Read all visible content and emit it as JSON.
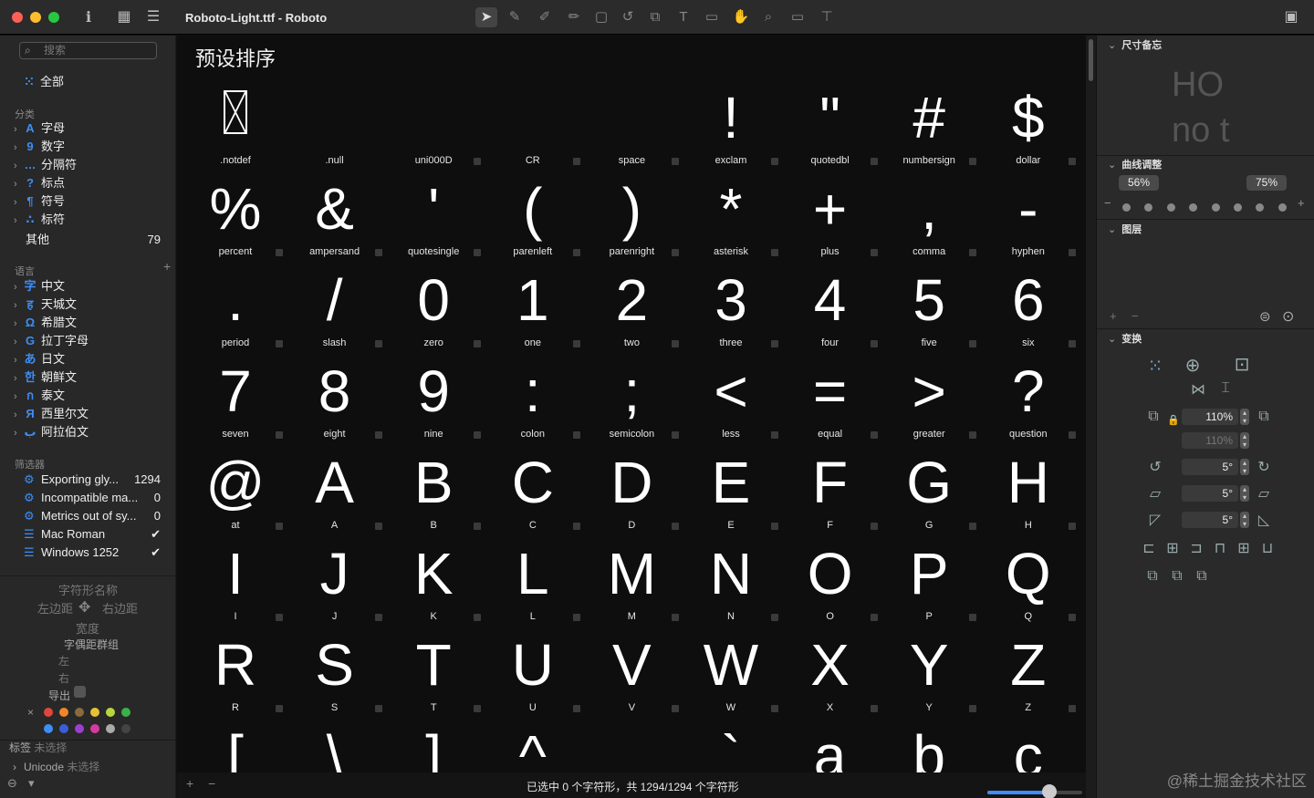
{
  "window": {
    "title": "Roboto-Light.ttf - Roboto"
  },
  "sidebar": {
    "search_placeholder": "搜索",
    "all": "全部",
    "categories_header": "分类",
    "categories": [
      {
        "icon": "A",
        "label": "字母"
      },
      {
        "icon": "9",
        "label": "数字"
      },
      {
        "icon": "…",
        "label": "分隔符"
      },
      {
        "icon": "?",
        "label": "标点"
      },
      {
        "icon": "¶",
        "label": "符号"
      },
      {
        "icon": "∴",
        "label": "标符"
      }
    ],
    "other": {
      "label": "其他",
      "count": "79"
    },
    "languages_header": "语言",
    "languages": [
      {
        "icon": "字",
        "label": "中文"
      },
      {
        "icon": "ह",
        "label": "天城文"
      },
      {
        "icon": "Ω",
        "label": "希腊文"
      },
      {
        "icon": "G",
        "label": "拉丁字母"
      },
      {
        "icon": "あ",
        "label": "日文"
      },
      {
        "icon": "한",
        "label": "朝鲜文"
      },
      {
        "icon": "ก",
        "label": "泰文"
      },
      {
        "icon": "Я",
        "label": "西里尔文"
      },
      {
        "icon": "ب",
        "label": "阿拉伯文"
      }
    ],
    "filters_header": "筛选器",
    "filters": [
      {
        "label": "Exporting gly...",
        "value": "1294"
      },
      {
        "label": "Incompatible ma...",
        "value": "0"
      },
      {
        "label": "Metrics out of sy...",
        "value": "0"
      },
      {
        "label": "Mac Roman",
        "value": "✔"
      },
      {
        "label": "Windows 1252",
        "value": "✔"
      }
    ],
    "info": {
      "glyph_name": "字符形名称",
      "left_sb": "左边距",
      "right_sb": "右边距",
      "width": "宽度",
      "kerning_group": "字偶距群组",
      "left": "左",
      "right": "右",
      "export": "导出"
    },
    "tags": {
      "label": "标签",
      "value": "未选择"
    },
    "unicode": {
      "label": "Unicode",
      "value": "未选择"
    }
  },
  "main": {
    "title": "预设排序",
    "glyphs": [
      {
        "char": "",
        "name": ".notdef"
      },
      {
        "char": "",
        "name": ".null"
      },
      {
        "char": "",
        "name": "uni000D"
      },
      {
        "char": "",
        "name": "CR"
      },
      {
        "char": "",
        "name": "space"
      },
      {
        "char": "!",
        "name": "exclam"
      },
      {
        "char": "\"",
        "name": "quotedbl"
      },
      {
        "char": "#",
        "name": "numbersign"
      },
      {
        "char": "$",
        "name": "dollar"
      },
      {
        "char": "%",
        "name": "percent"
      },
      {
        "char": "&",
        "name": "ampersand"
      },
      {
        "char": "'",
        "name": "quotesingle"
      },
      {
        "char": "(",
        "name": "parenleft"
      },
      {
        "char": ")",
        "name": "parenright"
      },
      {
        "char": "*",
        "name": "asterisk"
      },
      {
        "char": "+",
        "name": "plus"
      },
      {
        "char": ",",
        "name": "comma"
      },
      {
        "char": "-",
        "name": "hyphen"
      },
      {
        "char": ".",
        "name": "period"
      },
      {
        "char": "/",
        "name": "slash"
      },
      {
        "char": "0",
        "name": "zero"
      },
      {
        "char": "1",
        "name": "one"
      },
      {
        "char": "2",
        "name": "two"
      },
      {
        "char": "3",
        "name": "three"
      },
      {
        "char": "4",
        "name": "four"
      },
      {
        "char": "5",
        "name": "five"
      },
      {
        "char": "6",
        "name": "six"
      },
      {
        "char": "7",
        "name": "seven"
      },
      {
        "char": "8",
        "name": "eight"
      },
      {
        "char": "9",
        "name": "nine"
      },
      {
        "char": ":",
        "name": "colon"
      },
      {
        "char": ";",
        "name": "semicolon"
      },
      {
        "char": "<",
        "name": "less"
      },
      {
        "char": "=",
        "name": "equal"
      },
      {
        "char": ">",
        "name": "greater"
      },
      {
        "char": "?",
        "name": "question"
      },
      {
        "char": "@",
        "name": "at"
      },
      {
        "char": "A",
        "name": "A"
      },
      {
        "char": "B",
        "name": "B"
      },
      {
        "char": "C",
        "name": "C"
      },
      {
        "char": "D",
        "name": "D"
      },
      {
        "char": "E",
        "name": "E"
      },
      {
        "char": "F",
        "name": "F"
      },
      {
        "char": "G",
        "name": "G"
      },
      {
        "char": "H",
        "name": "H"
      },
      {
        "char": "I",
        "name": "I"
      },
      {
        "char": "J",
        "name": "J"
      },
      {
        "char": "K",
        "name": "K"
      },
      {
        "char": "L",
        "name": "L"
      },
      {
        "char": "M",
        "name": "M"
      },
      {
        "char": "N",
        "name": "N"
      },
      {
        "char": "O",
        "name": "O"
      },
      {
        "char": "P",
        "name": "P"
      },
      {
        "char": "Q",
        "name": "Q"
      },
      {
        "char": "R",
        "name": "R"
      },
      {
        "char": "S",
        "name": "S"
      },
      {
        "char": "T",
        "name": "T"
      },
      {
        "char": "U",
        "name": "U"
      },
      {
        "char": "V",
        "name": "V"
      },
      {
        "char": "W",
        "name": "W"
      },
      {
        "char": "X",
        "name": "X"
      },
      {
        "char": "Y",
        "name": "Y"
      },
      {
        "char": "Z",
        "name": "Z"
      },
      {
        "char": "[",
        "name": ""
      },
      {
        "char": "\\",
        "name": ""
      },
      {
        "char": "]",
        "name": ""
      },
      {
        "char": "^",
        "name": ""
      },
      {
        "char": "_",
        "name": ""
      },
      {
        "char": "`",
        "name": ""
      },
      {
        "char": "a",
        "name": ""
      },
      {
        "char": "b",
        "name": ""
      },
      {
        "char": "c",
        "name": ""
      }
    ],
    "status": "已选中 0 个字符形，共 1294/1294 个字符形",
    "zoom_fraction": 0.65
  },
  "inspector": {
    "dimensions": {
      "header": "尺寸备忘",
      "preview_top": "HO",
      "preview_bottom": "no t"
    },
    "curve": {
      "header": "曲线调整",
      "left": "56%",
      "right": "75%"
    },
    "layers": {
      "header": "图层"
    },
    "transform": {
      "header": "变换",
      "scale_x": "110%",
      "scale_y": "110%",
      "rotate": "5°",
      "slant": "5°",
      "skew": "5°"
    }
  },
  "watermark": "@稀土掘金技术社区",
  "colors": {
    "accent": "#3d8ef7",
    "label_dots": [
      "#e0463b",
      "#f0862a",
      "#8a6a3c",
      "#e8c234",
      "#b7d63c",
      "#3ab24a",
      "#3d8ef7",
      "#3a5ed8",
      "#9b3fd0",
      "#d63aa0",
      "#aaaaaa",
      "#444444"
    ]
  }
}
